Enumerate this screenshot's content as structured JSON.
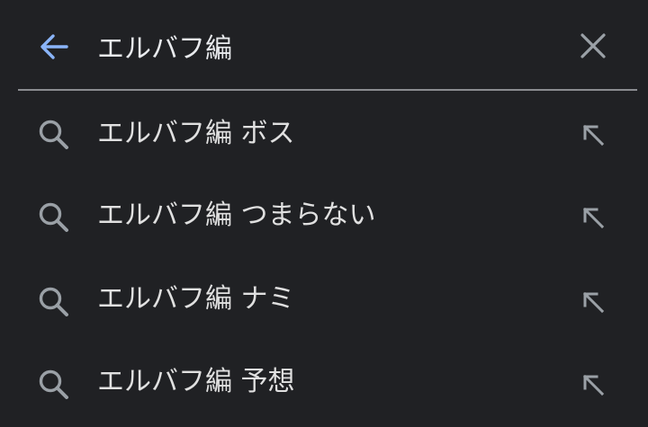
{
  "search": {
    "query": "エルバフ編"
  },
  "suggestions": [
    {
      "text": "エルバフ編 ボス"
    },
    {
      "text": "エルバフ編 つまらない"
    },
    {
      "text": "エルバフ編 ナミ"
    },
    {
      "text": "エルバフ編 予想"
    }
  ],
  "colors": {
    "background": "#202124",
    "accent": "#8ab4f8",
    "text": "#e8eaed",
    "icon": "#9aa0a6",
    "divider": "#8a8c90"
  },
  "icons": {
    "back": "arrow-left-icon",
    "clear": "close-icon",
    "suggestion": "search-icon",
    "fill_query": "arrow-up-left-icon"
  }
}
